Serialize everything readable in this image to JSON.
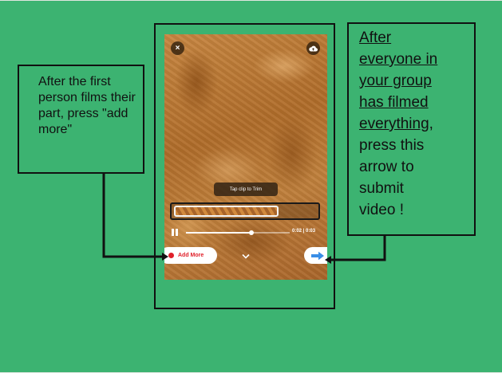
{
  "phone": {
    "close_icon": "×",
    "tap_label": "Tap clip to Trim",
    "time_text": "0:02 | 0:03",
    "progress": 0.63,
    "add_more_label": "Add More"
  },
  "callouts": {
    "left_text": "After the first person films their part, press \"add more\"",
    "right_underlined": [
      "After",
      "everyone in",
      "your group",
      "has filmed",
      "everything"
    ],
    "right_comma": ",",
    "right_rest": [
      "press this",
      "arrow to",
      "submit",
      "video !"
    ]
  },
  "colors": {
    "background": "#3cb371",
    "accent_red": "#e0202a",
    "arrow_blue": "#3a8ee6"
  },
  "icons": [
    "close-icon",
    "cloud-upload-icon",
    "pause-icon",
    "chevron-down-icon",
    "arrow-right-icon"
  ]
}
